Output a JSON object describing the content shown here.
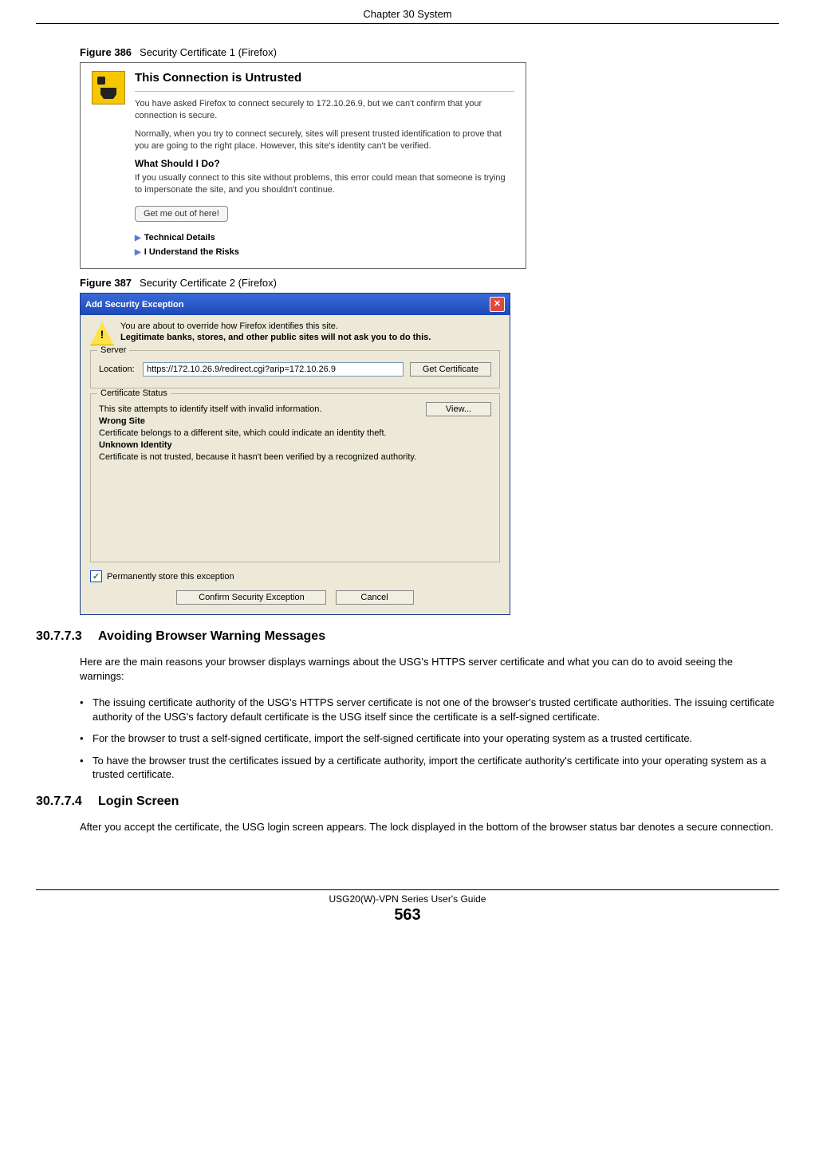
{
  "chapter_header": "Chapter 30 System",
  "fig386": {
    "caption_label": "Figure 386",
    "caption_text": "Security Certificate 1 (Firefox)",
    "title": "This Connection is Untrusted",
    "p1": "You have asked Firefox to connect securely to 172.10.26.9, but we can't confirm that your connection is secure.",
    "p2": "Normally, when you try to connect securely, sites will present trusted identification to prove that you are going to the right place. However, this site's identity can't be verified.",
    "subhead": "What Should I Do?",
    "p3": "If you usually connect to this site without problems, this error could mean that someone is trying to impersonate the site, and you shouldn't continue.",
    "getout_btn": "Get me out of here!",
    "disclosure1": "Technical Details",
    "disclosure2": "I Understand the Risks"
  },
  "fig387": {
    "caption_label": "Figure 387",
    "caption_text": "Security Certificate 2 (Firefox)",
    "titlebar": "Add Security Exception",
    "warn_line1": "You are about to override how Firefox identifies this site.",
    "warn_line2": "Legitimate banks, stores, and other public sites will not ask you to do this.",
    "server_legend": "Server",
    "location_label": "Location:",
    "location_value": "https://172.10.26.9/redirect.cgi?arip=172.10.26.9",
    "get_cert_btn": "Get Certificate",
    "status_legend": "Certificate Status",
    "status_intro": "This site attempts to identify itself with invalid information.",
    "view_btn": "View...",
    "wrong_site": "Wrong Site",
    "wrong_site_text": "Certificate belongs to a different site, which could indicate an identity theft.",
    "unknown_identity": "Unknown Identity",
    "unknown_identity_text": "Certificate is not trusted, because it hasn't been verified by a recognized authority.",
    "perm_store": "Permanently store this exception",
    "confirm_btn": "Confirm Security Exception",
    "cancel_btn": "Cancel"
  },
  "sec1": {
    "num": "30.7.7.3",
    "title": "Avoiding Browser Warning Messages",
    "intro": "Here are the main reasons your browser displays warnings about the USG's HTTPS server certificate and what you can do to avoid seeing the warnings:",
    "bullets": [
      "The issuing certificate authority of the USG's HTTPS server certificate is not one of the browser's trusted certificate authorities. The issuing certificate authority of the USG's factory default certificate is the USG itself since the certificate is a self-signed certificate.",
      "For the browser to trust a self-signed certificate, import the self-signed certificate into your operating system as a trusted certificate.",
      "To have the browser trust the certificates issued by a certificate authority, import the certificate authority's certificate into your operating system as a trusted certificate."
    ]
  },
  "sec2": {
    "num": "30.7.7.4",
    "title": "Login Screen",
    "p": "After you accept the certificate, the USG login screen appears. The lock displayed in the bottom of the browser status bar denotes a secure connection."
  },
  "footer": {
    "title": "USG20(W)-VPN Series User's Guide",
    "page": "563"
  }
}
